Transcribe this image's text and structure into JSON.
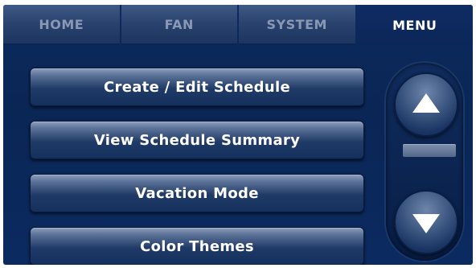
{
  "tabs": [
    {
      "label": "HOME",
      "active": false
    },
    {
      "label": "FAN",
      "active": false
    },
    {
      "label": "SYSTEM",
      "active": false
    },
    {
      "label": "MENU",
      "active": true
    }
  ],
  "menu": {
    "items": [
      {
        "label": "Create / Edit Schedule"
      },
      {
        "label": "View Schedule Summary"
      },
      {
        "label": "Vacation Mode"
      },
      {
        "label": "Color Themes"
      }
    ]
  },
  "scroll": {
    "up_icon": "triangle-up-icon",
    "down_icon": "triangle-down-icon"
  },
  "colors": {
    "background": "#0b2a60",
    "button_text": "#ffffff",
    "inactive_tab_text": "#8a98b4"
  }
}
